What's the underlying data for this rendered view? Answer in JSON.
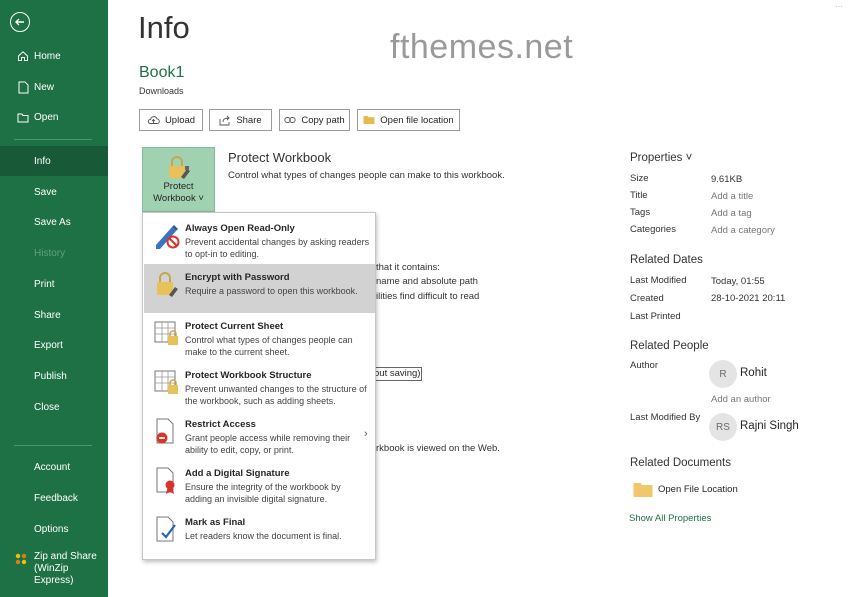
{
  "sidebar": {
    "items": [
      {
        "label": "Home",
        "icon": "home-icon"
      },
      {
        "label": "New",
        "icon": "new-document-icon"
      },
      {
        "label": "Open",
        "icon": "open-folder-icon"
      },
      {
        "label": "Info"
      },
      {
        "label": "Save"
      },
      {
        "label": "Save As"
      },
      {
        "label": "History"
      },
      {
        "label": "Print"
      },
      {
        "label": "Share"
      },
      {
        "label": "Export"
      },
      {
        "label": "Publish"
      },
      {
        "label": "Close"
      },
      {
        "label": "Account"
      },
      {
        "label": "Feedback"
      },
      {
        "label": "Options"
      },
      {
        "label": "Zip and Share (WinZip Express)",
        "icon": "winzip-icon"
      }
    ]
  },
  "page": {
    "title": "Info",
    "watermark": "fthemes.net",
    "book_name": "Book1",
    "book_location": "Downloads"
  },
  "actions": {
    "upload": "Upload",
    "share": "Share",
    "copy_path": "Copy path",
    "open_location": "Open file location"
  },
  "protect": {
    "button_line1": "Protect",
    "button_line2": "Workbook ˅",
    "title": "Protect Workbook",
    "description": "Control what types of changes people can make to this workbook."
  },
  "background_text": {
    "contains": "that it contains:",
    "name_path": "name and absolute path",
    "disabilities": "ilities find difficult to read",
    "without_saving": "out saving)",
    "web": "rkbook is viewed on the Web."
  },
  "menu": {
    "items": [
      {
        "title": "Always Open Read-Only",
        "desc": "Prevent accidental changes by asking readers to opt-in to editing."
      },
      {
        "title": "Encrypt with Password",
        "desc": "Require a password to open this workbook."
      },
      {
        "title": "Protect Current Sheet",
        "desc": "Control what types of changes people can make to the current sheet."
      },
      {
        "title": "Protect Workbook Structure",
        "desc": "Prevent unwanted changes to the structure of the workbook, such as adding sheets."
      },
      {
        "title": "Restrict Access",
        "desc": "Grant people access while removing their ability to edit, copy, or print."
      },
      {
        "title": "Add a Digital Signature",
        "desc": "Ensure the integrity of the workbook by adding an invisible digital signature."
      },
      {
        "title": "Mark as Final",
        "desc": "Let readers know the document is final."
      }
    ]
  },
  "properties": {
    "heading": "Properties ˅",
    "size_label": "Size",
    "size_value": "9.61KB",
    "title_label": "Title",
    "title_value": "Add a title",
    "tags_label": "Tags",
    "tags_value": "Add a tag",
    "categories_label": "Categories",
    "categories_value": "Add a category"
  },
  "dates": {
    "heading": "Related Dates",
    "modified_label": "Last Modified",
    "modified_value": "Today, 01:55",
    "created_label": "Created",
    "created_value": "28-10-2021 20:11",
    "printed_label": "Last Printed"
  },
  "people": {
    "heading": "Related People",
    "author_label": "Author",
    "author_initial": "R",
    "author_name": "Rohit",
    "add_author": "Add an author",
    "modified_by_label": "Last Modified By",
    "modified_by_initials": "RS",
    "modified_by_name": "Rajni Singh"
  },
  "documents": {
    "heading": "Related Documents",
    "open_location": "Open File Location",
    "show_all": "Show All Properties"
  }
}
